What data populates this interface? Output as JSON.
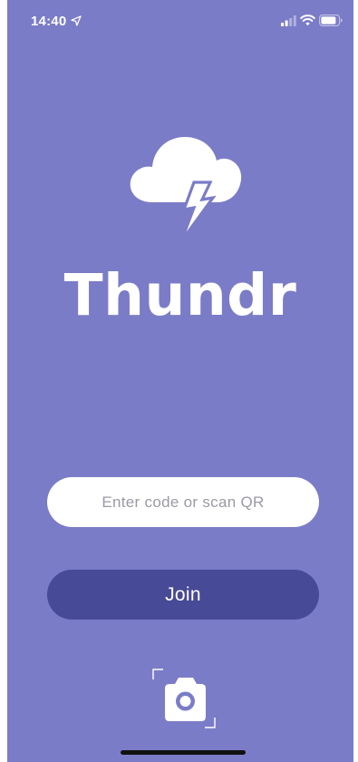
{
  "status_bar": {
    "time": "14:40",
    "location_icon": "location-arrow-icon",
    "signal_icon": "cellular-signal-icon",
    "wifi_icon": "wifi-icon",
    "battery_icon": "battery-icon"
  },
  "logo": {
    "icon": "cloud-lightning-icon"
  },
  "app": {
    "name": "Thundr"
  },
  "code_input": {
    "placeholder": "Enter code or scan QR",
    "value": ""
  },
  "join_button": {
    "label": "Join"
  },
  "scan_button": {
    "icon": "camera-scan-icon"
  },
  "colors": {
    "background": "#7b7cc7",
    "button": "#474a96",
    "input_background": "#ffffff",
    "placeholder": "#9a9aa6",
    "text": "#ffffff"
  }
}
